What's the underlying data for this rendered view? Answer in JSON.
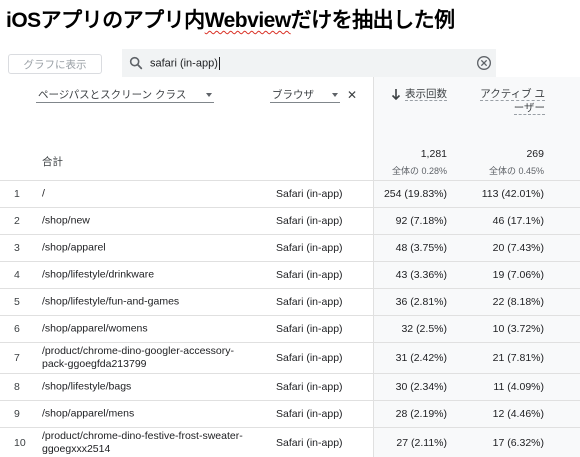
{
  "title": {
    "prefix": "iOSアプリのアプリ内",
    "webview": "Webview",
    "suffix": "だけを抽出した例"
  },
  "toolbar": {
    "graph_button": "グラフに表示",
    "search_value": "safari (in-app)"
  },
  "header": {
    "dimension1": "ページパスとスクリーン クラス",
    "dimension2": "ブラウザ",
    "metric1": "表示回数",
    "metric2_line1": "アクティブ ユ",
    "metric2_line2": "ーザー"
  },
  "totals": {
    "label": "合計",
    "metric1_value": "1,281",
    "metric1_pct": "全体の 0.28%",
    "metric2_value": "269",
    "metric2_pct": "全体の 0.45%"
  },
  "rows": [
    {
      "idx": "1",
      "page": "/",
      "browser": "Safari (in-app)",
      "views": "254 (19.83%)",
      "users": "113 (42.01%)"
    },
    {
      "idx": "2",
      "page": "/shop/new",
      "browser": "Safari (in-app)",
      "views": "92 (7.18%)",
      "users": "46 (17.1%)"
    },
    {
      "idx": "3",
      "page": "/shop/apparel",
      "browser": "Safari (in-app)",
      "views": "48 (3.75%)",
      "users": "20 (7.43%)"
    },
    {
      "idx": "4",
      "page": "/shop/lifestyle/drinkware",
      "browser": "Safari (in-app)",
      "views": "43 (3.36%)",
      "users": "19 (7.06%)"
    },
    {
      "idx": "5",
      "page": "/shop/lifestyle/fun-and-games",
      "browser": "Safari (in-app)",
      "views": "36 (2.81%)",
      "users": "22 (8.18%)"
    },
    {
      "idx": "6",
      "page": "/shop/apparel/womens",
      "browser": "Safari (in-app)",
      "views": "32 (2.5%)",
      "users": "10 (3.72%)"
    },
    {
      "idx": "7",
      "page": "/product/chrome-dino-googler-accessory-pack-ggoegfda213799",
      "browser": "Safari (in-app)",
      "views": "31 (2.42%)",
      "users": "21 (7.81%)"
    },
    {
      "idx": "8",
      "page": "/shop/lifestyle/bags",
      "browser": "Safari (in-app)",
      "views": "30 (2.34%)",
      "users": "11 (4.09%)"
    },
    {
      "idx": "9",
      "page": "/shop/apparel/mens",
      "browser": "Safari (in-app)",
      "views": "28 (2.19%)",
      "users": "12 (4.46%)"
    },
    {
      "idx": "10",
      "page": "/product/chrome-dino-festive-frost-sweater-ggoegxxx2514",
      "browser": "Safari (in-app)",
      "views": "27 (2.11%)",
      "users": "17 (6.32%)"
    }
  ]
}
